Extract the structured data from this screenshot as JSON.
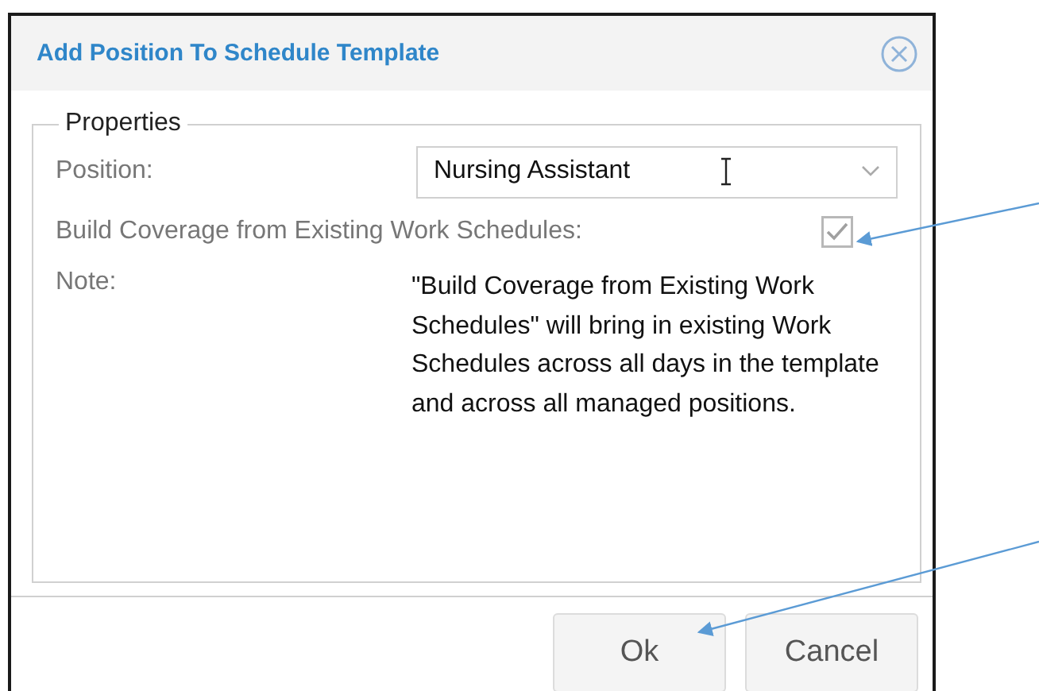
{
  "dialog": {
    "title": "Add Position To Schedule Template"
  },
  "properties": {
    "legend": "Properties",
    "position": {
      "label": "Position:",
      "value": "Nursing Assistant"
    },
    "build_coverage": {
      "label": "Build Coverage from Existing Work Schedules:",
      "checked": true,
      "disabled": true
    },
    "note": {
      "label": "Note:",
      "text": "\"Build Coverage from Existing Work Schedules\" will bring in existing Work Schedules across all days in the template and across all managed positions."
    }
  },
  "buttons": [
    {
      "label": "Ok"
    },
    {
      "label": "Cancel"
    }
  ]
}
